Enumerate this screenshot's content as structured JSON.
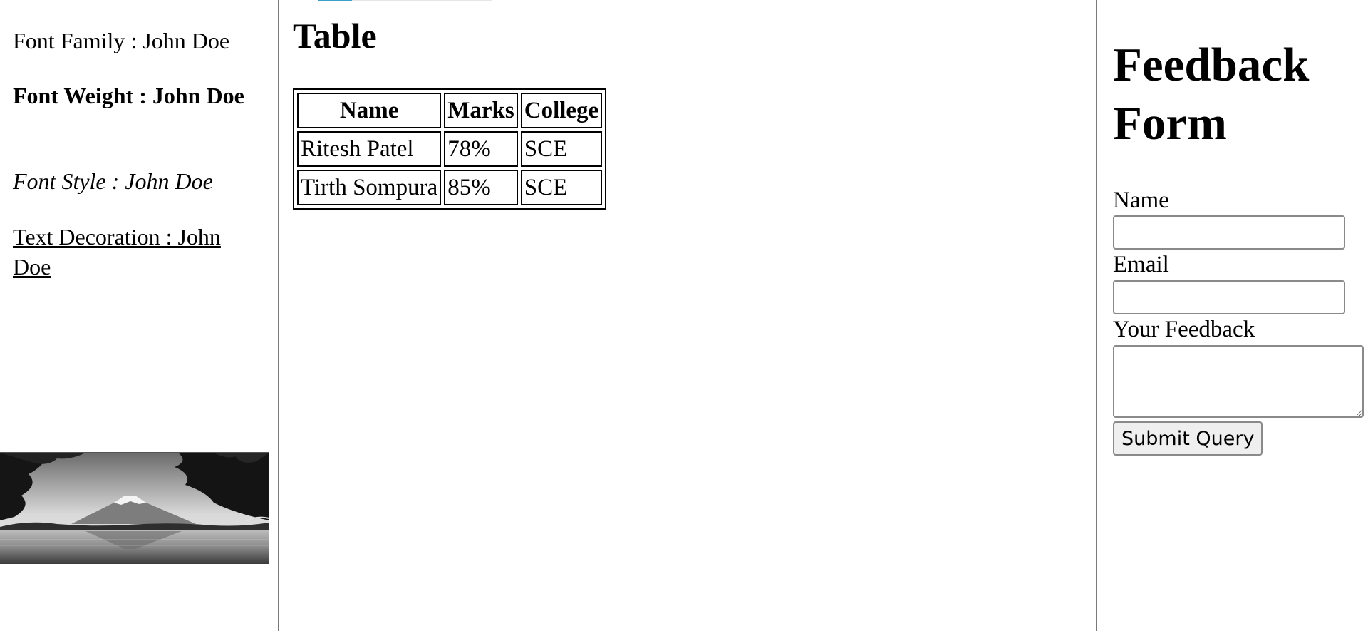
{
  "left": {
    "font_family": "Font Family : John Doe",
    "font_weight": "Font Weight : John Doe",
    "font_style": "Font Style : John Doe",
    "text_decoration": "Text Decoration : John Doe"
  },
  "middle": {
    "heading": "Table",
    "table": {
      "headers": [
        "Name",
        "Marks",
        "College"
      ],
      "rows": [
        [
          "Ritesh Patel",
          "78%",
          "SCE"
        ],
        [
          "Tirth Sompura",
          "85%",
          "SCE"
        ]
      ]
    }
  },
  "right": {
    "heading": "Feedback Form",
    "name_label": "Name",
    "email_label": "Email",
    "feedback_label": "Your Feedback",
    "submit_label": "Submit Query"
  }
}
